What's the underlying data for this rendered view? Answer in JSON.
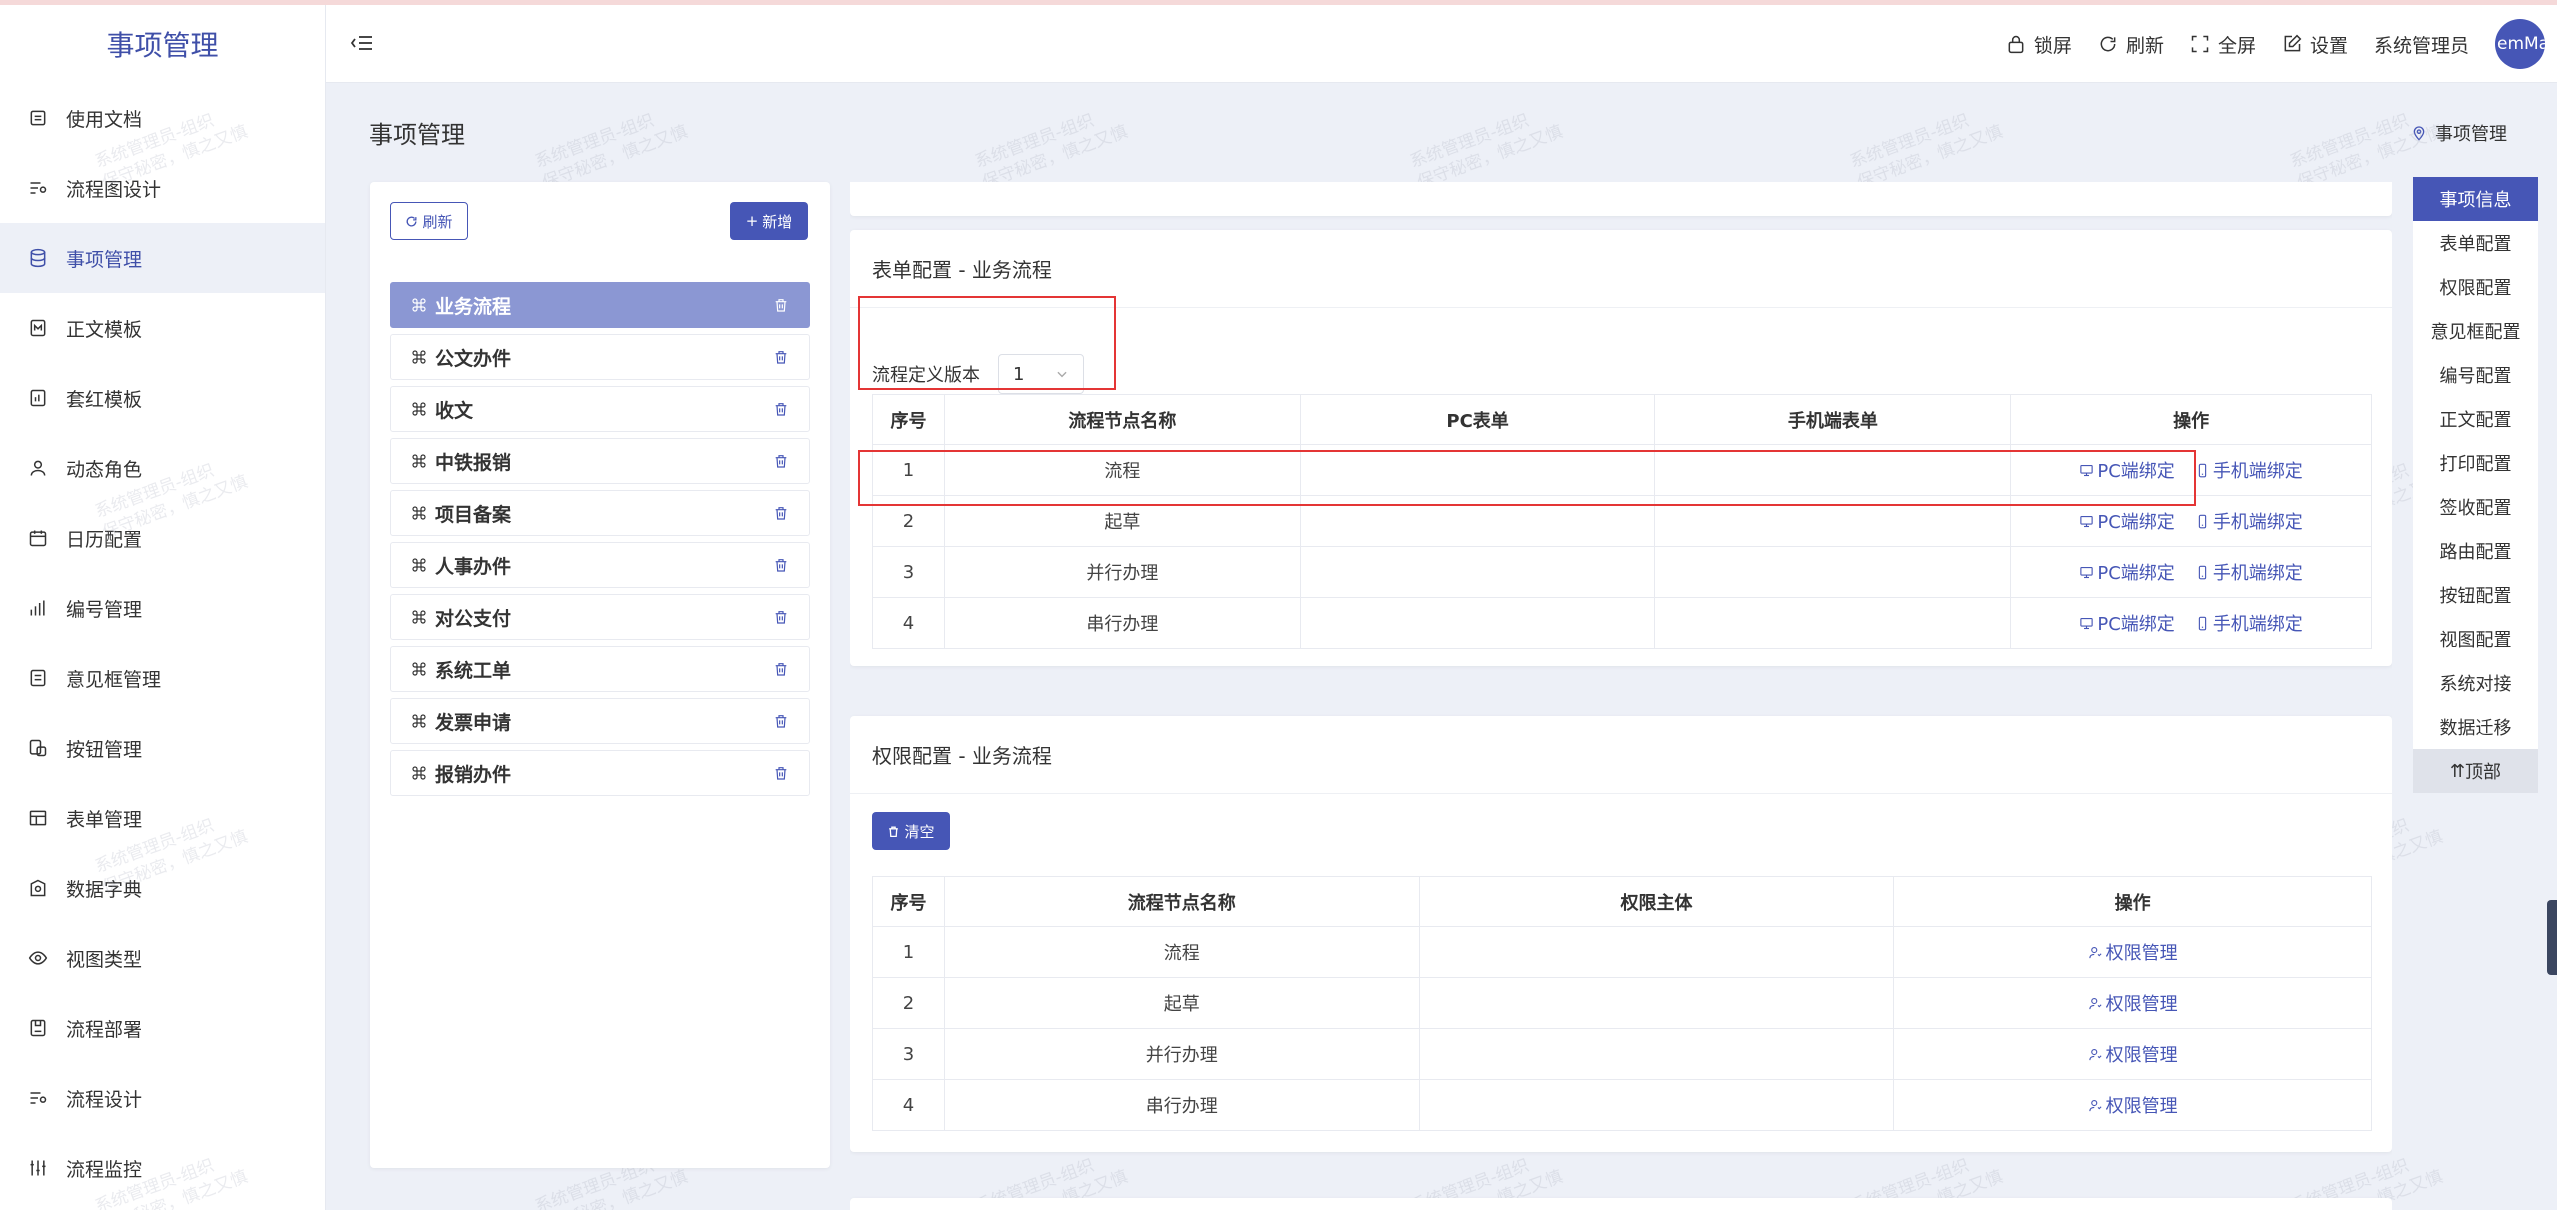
{
  "app_title": "事项管理",
  "header": {
    "lock": "锁屏",
    "refresh": "刷新",
    "fullscreen": "全屏",
    "settings": "设置",
    "user_name": "系统管理员",
    "avatar_text": "emMan"
  },
  "sidebar": {
    "items": [
      {
        "label": "使用文档",
        "icon": "doc-icon"
      },
      {
        "label": "流程图设计",
        "icon": "flow-icon"
      },
      {
        "label": "事项管理",
        "icon": "database-icon"
      },
      {
        "label": "正文模板",
        "icon": "template-icon"
      },
      {
        "label": "套红模板",
        "icon": "red-template-icon"
      },
      {
        "label": "动态角色",
        "icon": "user-icon"
      },
      {
        "label": "日历配置",
        "icon": "calendar-icon"
      },
      {
        "label": "编号管理",
        "icon": "bar-chart-icon"
      },
      {
        "label": "意见框管理",
        "icon": "comment-box-icon"
      },
      {
        "label": "按钮管理",
        "icon": "button-icon"
      },
      {
        "label": "表单管理",
        "icon": "table-icon"
      },
      {
        "label": "数据字典",
        "icon": "dictionary-icon"
      },
      {
        "label": "视图类型",
        "icon": "eye-icon"
      },
      {
        "label": "流程部署",
        "icon": "deploy-icon"
      },
      {
        "label": "流程设计",
        "icon": "design-icon"
      },
      {
        "label": "流程监控",
        "icon": "monitor-icon"
      }
    ]
  },
  "page": {
    "title": "事项管理",
    "breadcrumb": "事项管理"
  },
  "list_panel": {
    "refresh_label": "刷新",
    "add_label": "新增",
    "items": [
      "业务流程",
      "公文办件",
      "收文",
      "中铁报销",
      "项目备案",
      "人事办件",
      "对公支付",
      "系统工单",
      "发票申请",
      "报销办件"
    ]
  },
  "form_config": {
    "title": "表单配置 - 业务流程",
    "version_label": "流程定义版本",
    "version_value": "1",
    "headers": [
      "序号",
      "流程节点名称",
      "PC表单",
      "手机端表单",
      "操作"
    ],
    "pc_bind": "PC端绑定",
    "mobile_bind": "手机端绑定",
    "rows": [
      {
        "no": "1",
        "name": "流程"
      },
      {
        "no": "2",
        "name": "起草"
      },
      {
        "no": "3",
        "name": "并行办理"
      },
      {
        "no": "4",
        "name": "串行办理"
      }
    ]
  },
  "perm_config": {
    "title": "权限配置 - 业务流程",
    "clear_label": "清空",
    "headers": [
      "序号",
      "流程节点名称",
      "权限主体",
      "操作"
    ],
    "manage_label": "权限管理",
    "rows": [
      {
        "no": "1",
        "name": "流程"
      },
      {
        "no": "2",
        "name": "起草"
      },
      {
        "no": "3",
        "name": "并行办理"
      },
      {
        "no": "4",
        "name": "串行办理"
      }
    ]
  },
  "anchor_nav": [
    "事项信息",
    "表单配置",
    "权限配置",
    "意见框配置",
    "编号配置",
    "正文配置",
    "打印配置",
    "签收配置",
    "路由配置",
    "按钮配置",
    "视图配置",
    "系统对接",
    "数据迁移"
  ],
  "anchor_top": "顶部",
  "watermark": [
    "系统管理员-组织",
    "保守秘密，慎之又慎"
  ]
}
